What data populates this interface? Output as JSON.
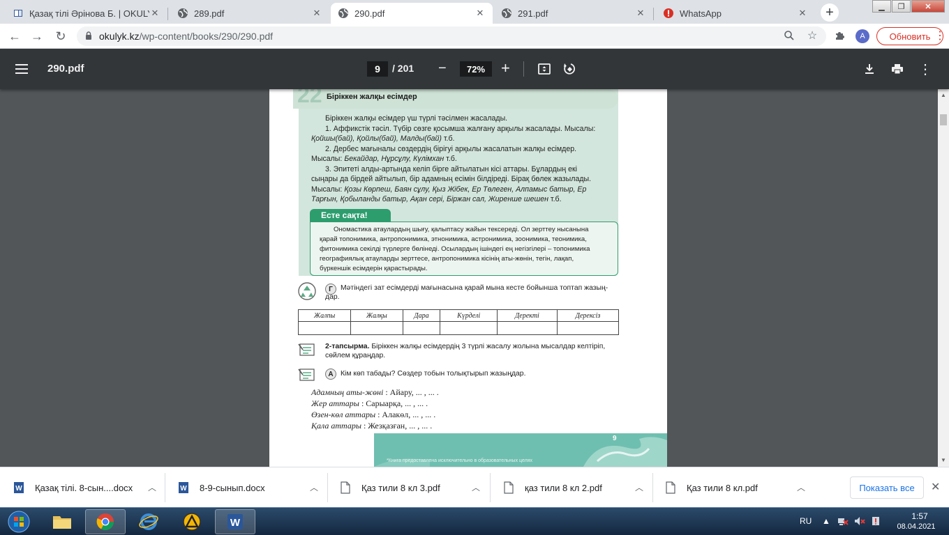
{
  "browser": {
    "tabs": [
      {
        "title": "Қазақ тілі Әрінова Б. | OKULYK.",
        "icon": "book-icon"
      },
      {
        "title": "289.pdf",
        "icon": "globe-icon"
      },
      {
        "title": "290.pdf",
        "icon": "globe-icon",
        "active": true
      },
      {
        "title": "291.pdf",
        "icon": "globe-icon"
      },
      {
        "title": "WhatsApp",
        "icon": "alert-icon"
      }
    ],
    "new_tab": "+",
    "url_host": "okulyk.kz",
    "url_path": "/wp-content/books/290/290.pdf",
    "profile_initial": "A",
    "update_label": "Обновить"
  },
  "pdf": {
    "title": "290.pdf",
    "page_current": "9",
    "page_total": "/ 201",
    "zoom": "72%"
  },
  "document": {
    "section_title": "Біріккен  жалқы  есімдер",
    "body": {
      "l1": "Біріккен жалқы есімдер үш түрлі тәсілмен жасалады.",
      "l2": "1. Аффикстік тәсіл. Түбір сөзге қосымша жалғану арқылы жасалады. Мысалы:",
      "l3_ex": "Қойшы(бай), Қойлы(бай), Малды(бай)",
      "l3_end": " т.б.",
      "l4": "2. Дербес мағыналы сөздердің бірігуі арқылы жасалатын жалқы есімдер.",
      "l5_pre": "Мысалы: ",
      "l5_ex": "Бекайдар, Нұрсұлу, Күлімхан",
      "l5_end": " т.б.",
      "l6": "3. Эпитеті алды-артында келіп бірге айтылатын кісі аттары. Бұлардың екі",
      "l7": "сыңары да бірдей айтылып, бір адамның есімін білдіреді. Бірақ бөлек жазылады.",
      "l8_pre": "Мысалы: ",
      "l8_ex": "Қозы Көрпеш, Баян сұлу, Қыз Жібек, Ер Төлеген, Алпамыс батыр, Ер",
      "l9_ex": "Тарғын, Қобыланды батыр, Ақан сері, Біржан сал, Жиренше шешен",
      "l9_end": " т.б."
    },
    "remember": {
      "title": "Есте сақта!",
      "l1": "Ономастика атаулардың шығу, қалыптасу жайын тексереді. Ол зерттеу нысанына",
      "l2": "қарай топонимика, антропонимика, этнонимика, астронимика, зоонимика, теонимика,",
      "l3": "фитонимика секілді түрлерге бөлінеді. Осылардың ішіндегі ең негізгілері – топонимика",
      "l4": "географиялық атауларды зерттесе, антропонимика кісінің аты-жөнін, тегін, лақап,",
      "l5": "бүркеншік есімдерін қарастырады."
    },
    "task_g": {
      "letter": "Г",
      "l1": "Мәтіндегі зат есімдерді мағынасына қарай мына кесте бойынша топтап жазың-",
      "l2": "дар."
    },
    "table_headers": [
      "Жалпы",
      "Жалқы",
      "Дара",
      "Күрделі",
      "Деректі",
      "Дерексіз"
    ],
    "task_2": {
      "label": "2-тапсырма.",
      "l1": " Біріккен жалқы есімдердің 3 түрлі жасалу жолына мысалдар келтіріп,",
      "l2": "сөйлем құраңдар."
    },
    "task_a": {
      "letter": "А",
      "l1": "Кім көп табады? Сөздер тобын толықтырып жазыңдар."
    },
    "handwritten": [
      {
        "label": "Адамның   аты-жөні",
        "value": " : Айару,   ...  , ...  ."
      },
      {
        "label": "Жер  аттары",
        "value": "  : Сарыарқа,   ...  , ...  ."
      },
      {
        "label": "Өзен-көл   аттары",
        "value": "  : Алакөл,   ...  , ...  ."
      },
      {
        "label": "Қала  аттары",
        "value": "  : Жезқазған,    ...  , ...  ."
      }
    ],
    "page_number": "9",
    "footer_note": "*Книга предоставлена исключительно в образовательных целях"
  },
  "downloads": {
    "items": [
      {
        "name": "Қазақ тілі. 8-сын....docx",
        "icon": "word-doc-icon"
      },
      {
        "name": "8-9-сынып.docx",
        "icon": "word-doc-icon"
      },
      {
        "name": "Қаз тили 8 кл 3.pdf",
        "icon": "file-icon"
      },
      {
        "name": "қаз тили 8 кл 2.pdf",
        "icon": "file-icon"
      },
      {
        "name": "Қаз тили 8 кл.pdf",
        "icon": "file-icon"
      }
    ],
    "show_all": "Показать все"
  },
  "taskbar": {
    "lang": "RU",
    "time": "1:57",
    "date": "08.04.2021"
  },
  "colors": {
    "pdf_toolbar": "#323639",
    "viewer_bg": "#525659",
    "panel_green": "#d3e6dd",
    "accent_green": "#2d9d6e",
    "update_red": "#d93025",
    "link_blue": "#1a73e8"
  }
}
